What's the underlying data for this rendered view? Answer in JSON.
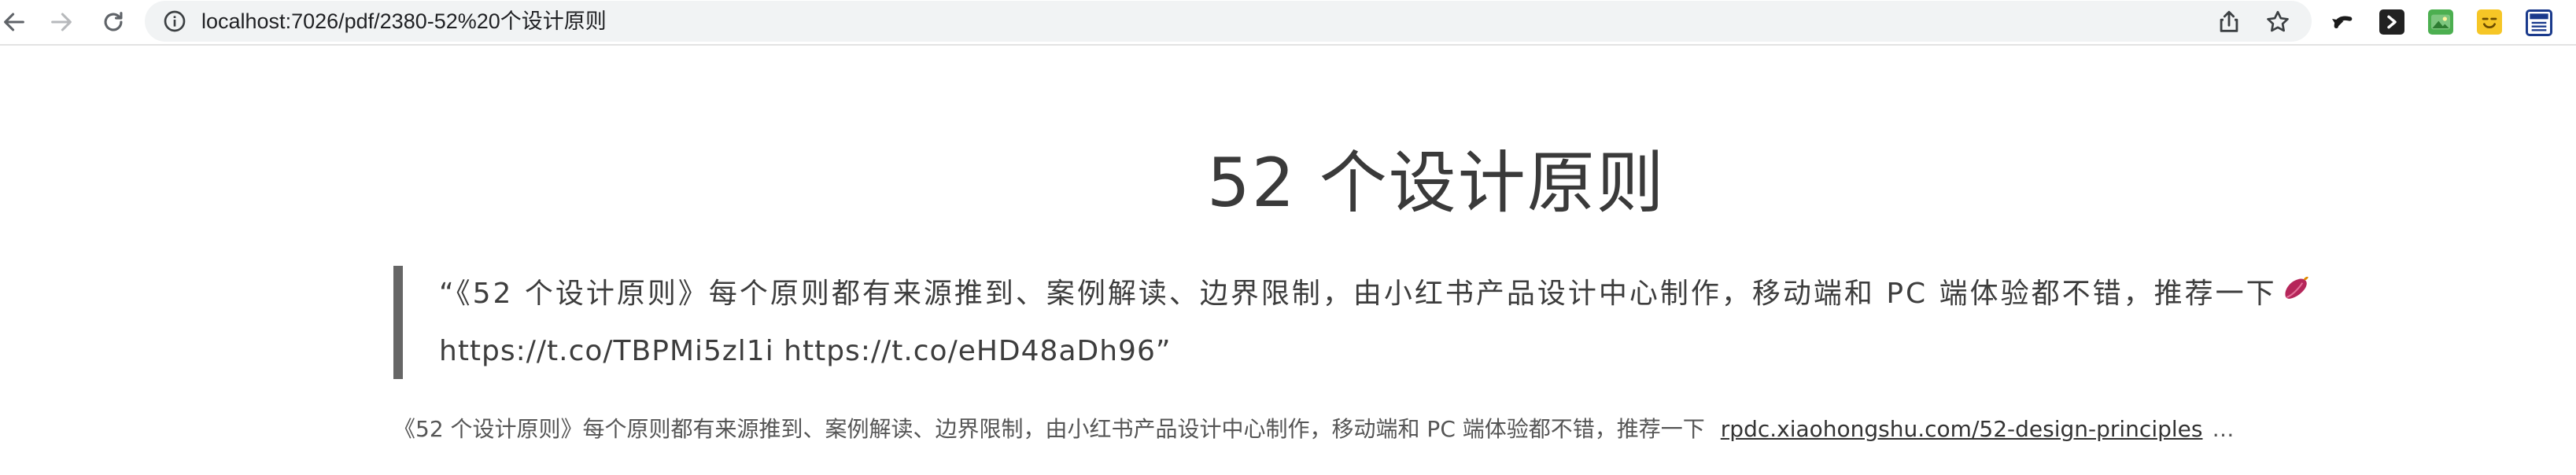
{
  "browser": {
    "url": "localhost:7026/pdf/2380-52%20个设计原则"
  },
  "page": {
    "title": "52 个设计原则",
    "quote": {
      "line1": "“《52 个设计原则》每个原则都有来源推到、案例解读、边界限制，由小红书产品设计中心制作，移动端和 PC 端体验都不错，推荐一下",
      "line2": "https://t.co/TBPMi5zl1i https://t.co/eHD48aDh96”",
      "emoji_icon": "sweet-potato-icon"
    },
    "description": {
      "text": "《52 个设计原则》每个原则都有来源推到、案例解读、边界限制，由小红书产品设计中心制作，移动端和 PC 端体验都不错，推荐一下",
      "link": "rpdc.xiaohongshu.com/52-design-principles",
      "ellipsis": "…"
    }
  },
  "colors": {
    "quote_border": "#666666",
    "omnibox_bg": "#f1f3f4"
  }
}
